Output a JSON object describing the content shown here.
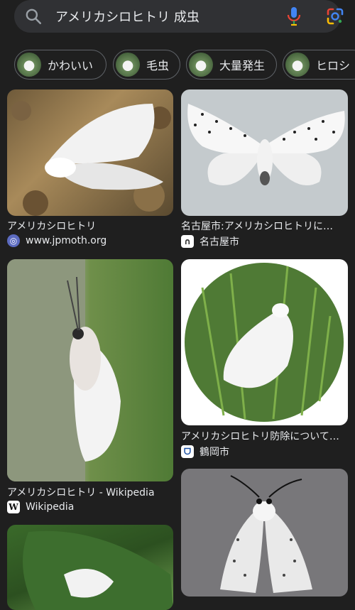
{
  "search": {
    "query": "アメリカシロヒトリ 成虫"
  },
  "chips": [
    {
      "label": "かわいい"
    },
    {
      "label": "毛虫"
    },
    {
      "label": "大量発生"
    },
    {
      "label": "ヒロシ"
    }
  ],
  "results": [
    {
      "title": "アメリカシロヒトリ",
      "source": "www.jpmoth.org"
    },
    {
      "title": "名古屋市:アメリカシロヒトリに…",
      "source": "名古屋市"
    },
    {
      "title": "アメリカシロヒトリ - Wikipedia",
      "source": "Wikipedia"
    },
    {
      "title": "アメリカシロヒトリ防除について…",
      "source": "鶴岡市"
    }
  ],
  "colors": {
    "background": "#1f1f1f",
    "search_bar": "#303134",
    "text": "#e8eaed"
  },
  "icons": {
    "search": "search-icon",
    "mic": "mic-icon",
    "lens": "google-lens-icon"
  }
}
